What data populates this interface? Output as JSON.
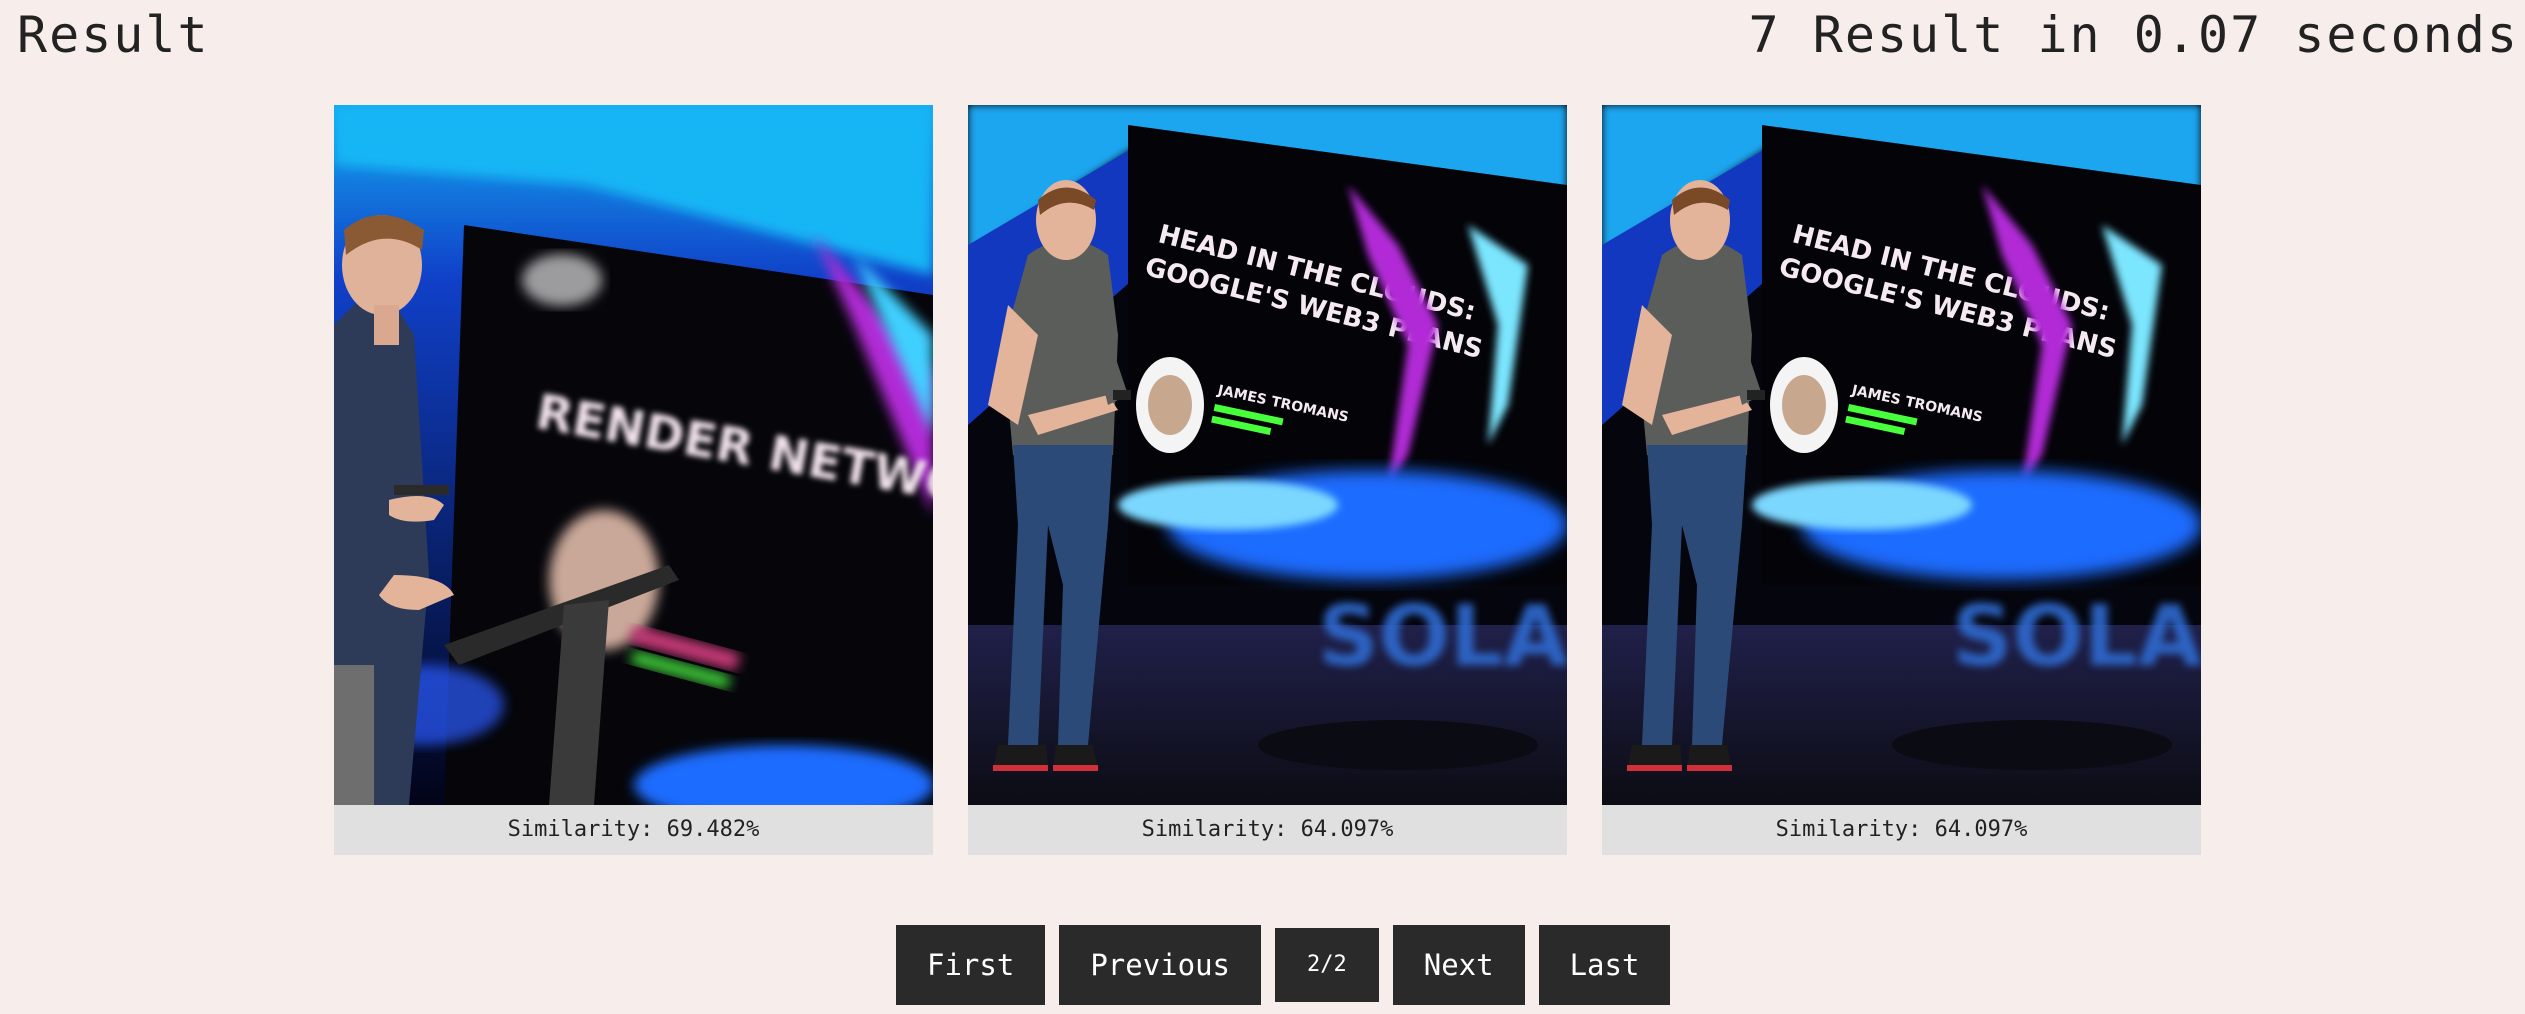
{
  "header": {
    "title": "Result",
    "stats": "7 Result in 0.07 seconds"
  },
  "results": [
    {
      "similarity": "Similarity: 69.482%"
    },
    {
      "similarity": "Similarity: 64.097%"
    },
    {
      "similarity": "Similarity: 64.097%"
    }
  ],
  "pagination": {
    "first": "First",
    "previous": "Previous",
    "page": "2/2",
    "next": "Next",
    "last": "Last"
  },
  "images": {
    "image1": {
      "slide_line1": "RENDER NETWORK"
    },
    "image2": {
      "slide_line1": "HEAD IN THE CLOUDS:",
      "slide_line2": "GOOGLE'S WEB3 PLANS",
      "speaker": "JAMES TROMANS",
      "stage": "SOLAN"
    },
    "image3": {
      "slide_line1": "HEAD IN THE CLOUDS:",
      "slide_line2": "GOOGLE'S WEB3 PLANS",
      "speaker": "JAMES TROMANS",
      "stage": "SOLAN"
    }
  },
  "colors": {
    "background": "#f7eeeb",
    "caption_bg": "#e0e0e0",
    "button_bg": "#2a2a2a",
    "stage_blue": "#1a6cff",
    "accent_green": "#47ff3a"
  }
}
